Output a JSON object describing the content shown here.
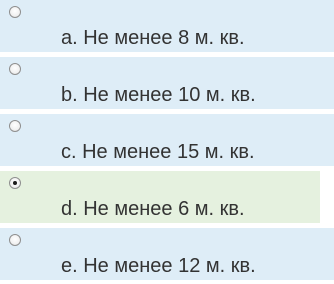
{
  "question": {
    "options": [
      {
        "letter": "a.",
        "text": "Не менее 8 м. кв.",
        "label": "a. Не менее 8 м. кв.",
        "selected": false
      },
      {
        "letter": "b.",
        "text": "Не менее 10 м. кв.",
        "label": "b. Не менее 10 м. кв.",
        "selected": false
      },
      {
        "letter": "c.",
        "text": "Не менее 15 м. кв.",
        "label": "c. Не менее 15 м. кв.",
        "selected": false
      },
      {
        "letter": "d.",
        "text": "Не менее 6 м. кв.",
        "label": "d. Не менее 6 м. кв.",
        "selected": true
      },
      {
        "letter": "e.",
        "text": "Не менее 12 м. кв.",
        "label": "e. Не менее 12 м. кв.",
        "selected": false
      }
    ]
  },
  "colors": {
    "option_background": "#deedf7",
    "selected_background": "#e5f1df",
    "text": "#333333"
  }
}
